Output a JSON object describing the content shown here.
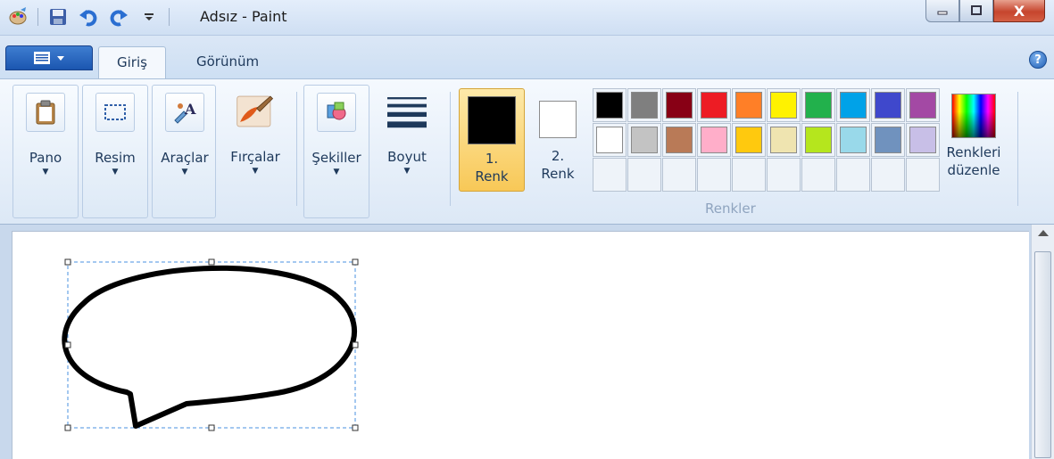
{
  "window": {
    "title": "Adsız - Paint",
    "close_glyph": "X"
  },
  "quick_access": [
    {
      "icon": "paint-app-icon"
    },
    {
      "icon": "save-icon"
    },
    {
      "icon": "undo-icon"
    },
    {
      "icon": "redo-icon"
    },
    {
      "icon": "customize-dropdown-icon"
    }
  ],
  "tabs": {
    "home": "Giriş",
    "view": "Görünüm",
    "help_glyph": "?"
  },
  "ribbon": {
    "groups": {
      "clipboard": "Pano",
      "image": "Resim",
      "tools": "Araçlar",
      "brushes": "Fırçalar",
      "shapes": "Şekiller",
      "size": "Boyut"
    },
    "colors": {
      "group_label": "Renkler",
      "color1_number": "1.",
      "color1_label": "Renk",
      "color2_number": "2.",
      "color2_label": "Renk",
      "color1_value": "#000000",
      "color2_value": "#ffffff",
      "edit_line1": "Renkleri",
      "edit_line2": "düzenle",
      "palette": [
        "#000000",
        "#7f7f7f",
        "#880015",
        "#ed1c24",
        "#ff7f27",
        "#fff200",
        "#22b14c",
        "#00a2e8",
        "#3f48cc",
        "#a349a4",
        "#ffffff",
        "#c3c3c3",
        "#b97a57",
        "#ffaec9",
        "#ffc90e",
        "#efe4b0",
        "#b5e61d",
        "#99d9ea",
        "#7092be",
        "#c8bfe7"
      ],
      "empty_slots": 10
    }
  },
  "canvas": {
    "shape": "speech-bubble",
    "selection": "dashed"
  }
}
